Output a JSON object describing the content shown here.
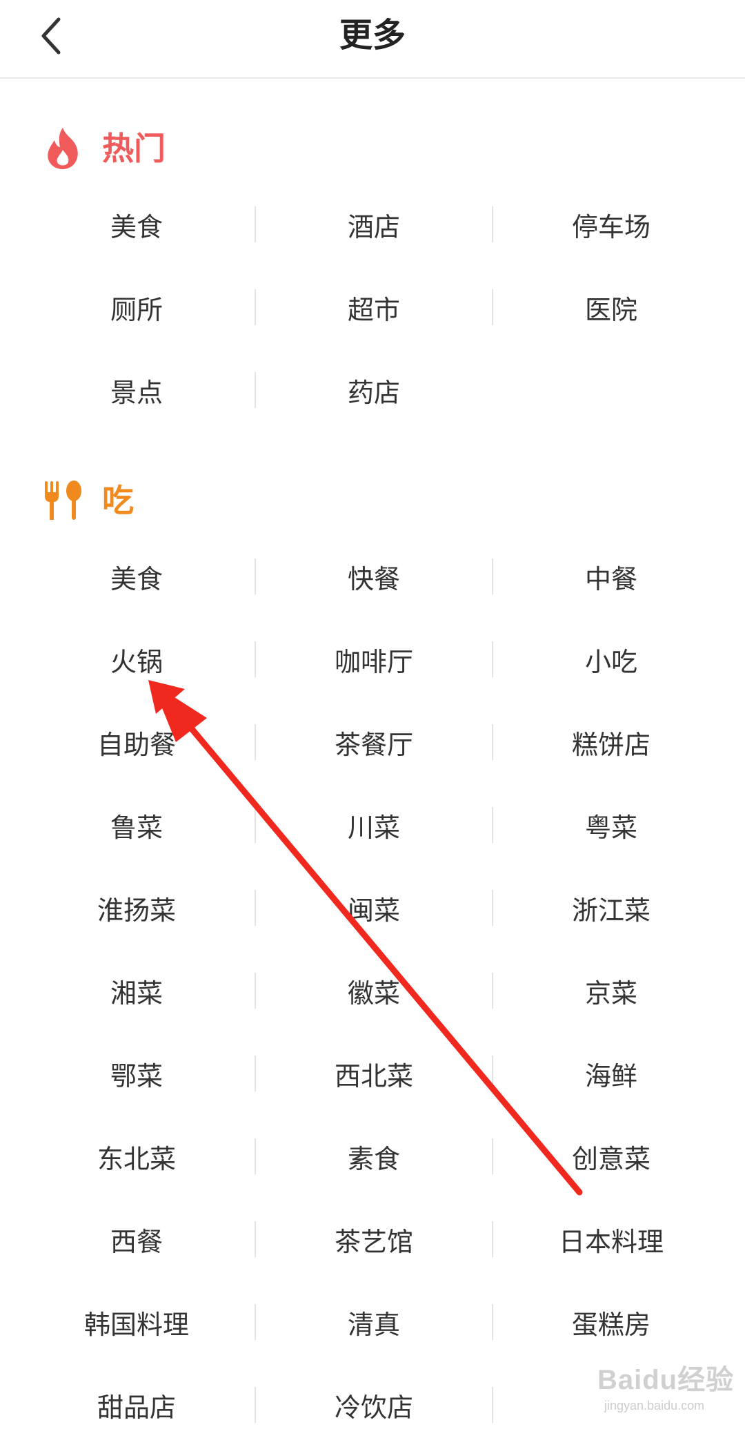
{
  "header": {
    "title": "更多",
    "back_icon": "chevron-left-icon"
  },
  "sections": [
    {
      "title": "热门",
      "icon": "flame-icon",
      "color": "#f05a5a",
      "rows": [
        [
          "美食",
          "酒店",
          "停车场"
        ],
        [
          "厕所",
          "超市",
          "医院"
        ],
        [
          "景点",
          "药店",
          ""
        ]
      ]
    },
    {
      "title": "吃",
      "icon": "fork-spoon-icon",
      "color": "#f08a1e",
      "rows": [
        [
          "美食",
          "快餐",
          "中餐"
        ],
        [
          "火锅",
          "咖啡厅",
          "小吃"
        ],
        [
          "自助餐",
          "茶餐厅",
          "糕饼店"
        ],
        [
          "鲁菜",
          "川菜",
          "粤菜"
        ],
        [
          "淮扬菜",
          "闽菜",
          "浙江菜"
        ],
        [
          "湘菜",
          "徽菜",
          "京菜"
        ],
        [
          "鄂菜",
          "西北菜",
          "海鲜"
        ],
        [
          "东北菜",
          "素食",
          "创意菜"
        ],
        [
          "西餐",
          "茶艺馆",
          "日本料理"
        ],
        [
          "韩国料理",
          "清真",
          "蛋糕房"
        ],
        [
          "甜品店",
          "冷饮店",
          ""
        ]
      ]
    }
  ],
  "annotation": {
    "icon": "red-arrow-icon",
    "color": "#f0281e"
  },
  "watermark": {
    "brand": "Baidu经验",
    "url": "jingyan.baidu.com"
  }
}
